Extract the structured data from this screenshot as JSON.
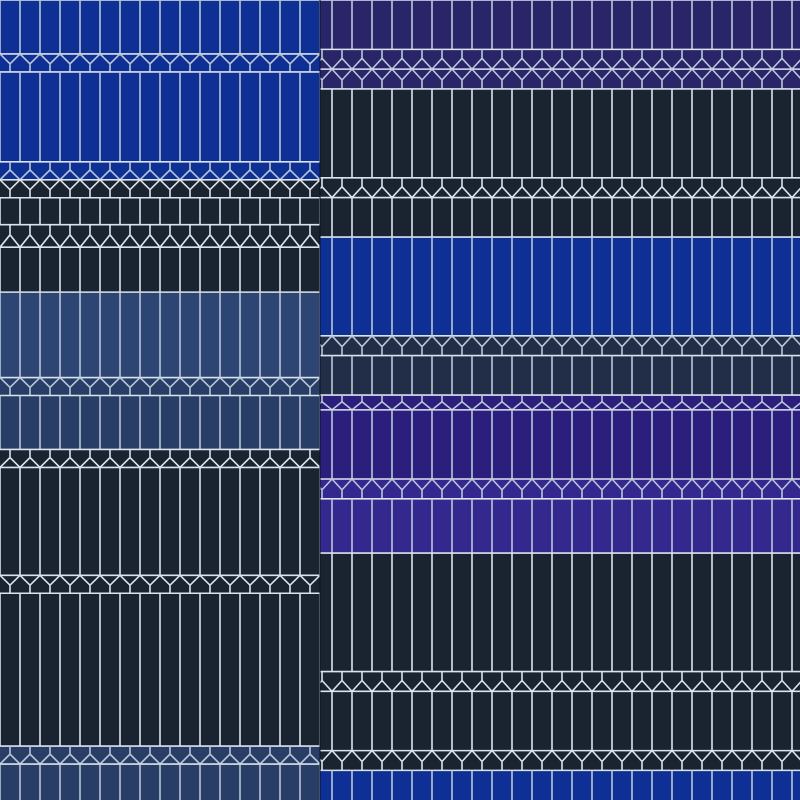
{
  "colors": {
    "line": "#dbe3ee",
    "line_soft": "#b9c6d8",
    "dark": "#1a2430",
    "cobalt": "#0e2f94",
    "slate_blue": "#2c4573",
    "steel_blue": "#283e66",
    "navy": "#222e48",
    "indigo": "#2a2468",
    "deep_violet": "#2b1e7c",
    "violet": "#34288f"
  },
  "panels": [
    {
      "name": "left",
      "bands": [
        {
          "fill": "cobalt",
          "style": "plain",
          "span": 12
        },
        {
          "fill": "cobalt",
          "style": "chevron-down",
          "span": 4
        },
        {
          "fill": "cobalt",
          "style": "plain",
          "span": 20
        },
        {
          "fill": "cobalt",
          "style": "chevron-up",
          "span": 4
        },
        {
          "fill": "dark",
          "style": "chevron-down",
          "span": 4
        },
        {
          "fill": "dark",
          "style": "plain",
          "span": 6
        },
        {
          "fill": "dark",
          "style": "chevron-up",
          "span": 5
        },
        {
          "fill": "dark",
          "style": "plain",
          "span": 10
        },
        {
          "fill": "slate_blue",
          "style": "plain",
          "span": 19
        },
        {
          "fill": "steel_blue",
          "style": "chevron-down",
          "span": 4
        },
        {
          "fill": "steel_blue",
          "style": "plain",
          "span": 12
        },
        {
          "fill": "dark",
          "style": "chevron-up",
          "span": 4
        },
        {
          "fill": "dark",
          "style": "plain",
          "span": 24
        },
        {
          "fill": "dark",
          "style": "chevron-down",
          "span": 4
        },
        {
          "fill": "dark",
          "style": "plain",
          "span": 34
        },
        {
          "fill": "steel_blue",
          "style": "chevron-up",
          "span": 4
        },
        {
          "fill": "steel_blue",
          "style": "plain",
          "span": 8
        }
      ]
    },
    {
      "name": "right",
      "bands": [
        {
          "fill": "indigo",
          "style": "plain",
          "span": 10
        },
        {
          "fill": "indigo",
          "style": "chevron-up",
          "span": 4
        },
        {
          "fill": "indigo",
          "style": "chevron-down",
          "span": 4
        },
        {
          "fill": "dark",
          "style": "plain",
          "span": 18
        },
        {
          "fill": "dark",
          "style": "chevron-up",
          "span": 4
        },
        {
          "fill": "dark",
          "style": "plain",
          "span": 8
        },
        {
          "fill": "cobalt",
          "style": "plain",
          "span": 20
        },
        {
          "fill": "navy",
          "style": "chevron-down",
          "span": 4
        },
        {
          "fill": "navy",
          "style": "plain",
          "span": 8
        },
        {
          "fill": "deep_violet",
          "style": "chevron-up",
          "span": 3
        },
        {
          "fill": "deep_violet",
          "style": "plain",
          "span": 14
        },
        {
          "fill": "violet",
          "style": "chevron-down",
          "span": 4
        },
        {
          "fill": "violet",
          "style": "plain",
          "span": 11
        },
        {
          "fill": "dark",
          "style": "plain",
          "span": 24
        },
        {
          "fill": "dark",
          "style": "chevron-up",
          "span": 4
        },
        {
          "fill": "dark",
          "style": "plain",
          "span": 12
        },
        {
          "fill": "dark",
          "style": "chevron-down",
          "span": 4
        },
        {
          "fill": "cobalt",
          "style": "plain",
          "span": 6
        }
      ]
    }
  ]
}
